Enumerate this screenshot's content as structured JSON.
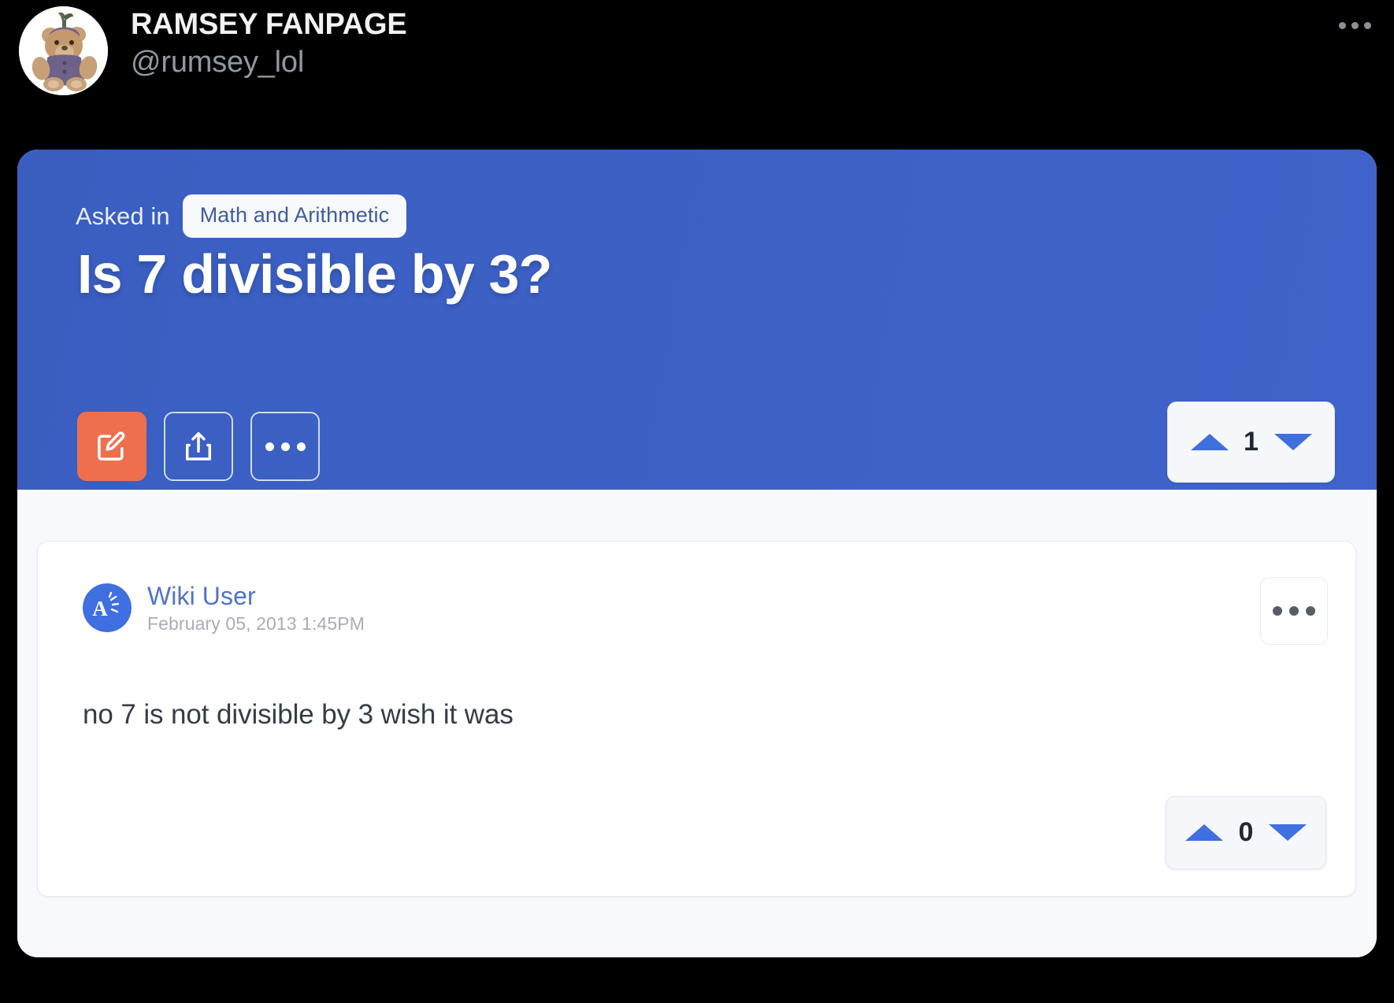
{
  "tweet": {
    "display_name": "RAMSEY FANPAGE",
    "handle": "@rumsey_lol",
    "avatar_icon": "teddy-bear-in-eggplant-costume",
    "menu_icon": "ellipsis-icon"
  },
  "card": {
    "hero": {
      "asked_label": "Asked in",
      "category": "Math and Arithmetic",
      "question": "Is 7 divisible by 3?",
      "actions": [
        {
          "name": "edit-button",
          "icon": "pencil-square-icon",
          "style": "primary"
        },
        {
          "name": "share-button",
          "icon": "share-upload-icon",
          "style": "ghost"
        },
        {
          "name": "more-button",
          "icon": "ellipsis-icon",
          "style": "ghost"
        }
      ],
      "vote": {
        "upvote_icon": "triangle-up-icon",
        "downvote_icon": "triangle-down-icon",
        "count": "1"
      }
    },
    "answer": {
      "avatar_icon": "wiki-answers-a-icon",
      "author": "Wiki User",
      "date": "February 05, 2013 1:45PM",
      "menu_icon": "ellipsis-icon",
      "text": "no 7 is not divisible by 3 wish it was",
      "vote": {
        "upvote_icon": "triangle-up-icon",
        "downvote_icon": "triangle-down-icon",
        "count": "0"
      }
    }
  },
  "colors": {
    "page_background": "#000000",
    "hero_blue": "#3d61c6",
    "accent_orange": "#ee6f4e",
    "vote_blue": "#3f6fe0",
    "card_background": "#f7f9fc",
    "author_blue": "#4f74c9"
  }
}
